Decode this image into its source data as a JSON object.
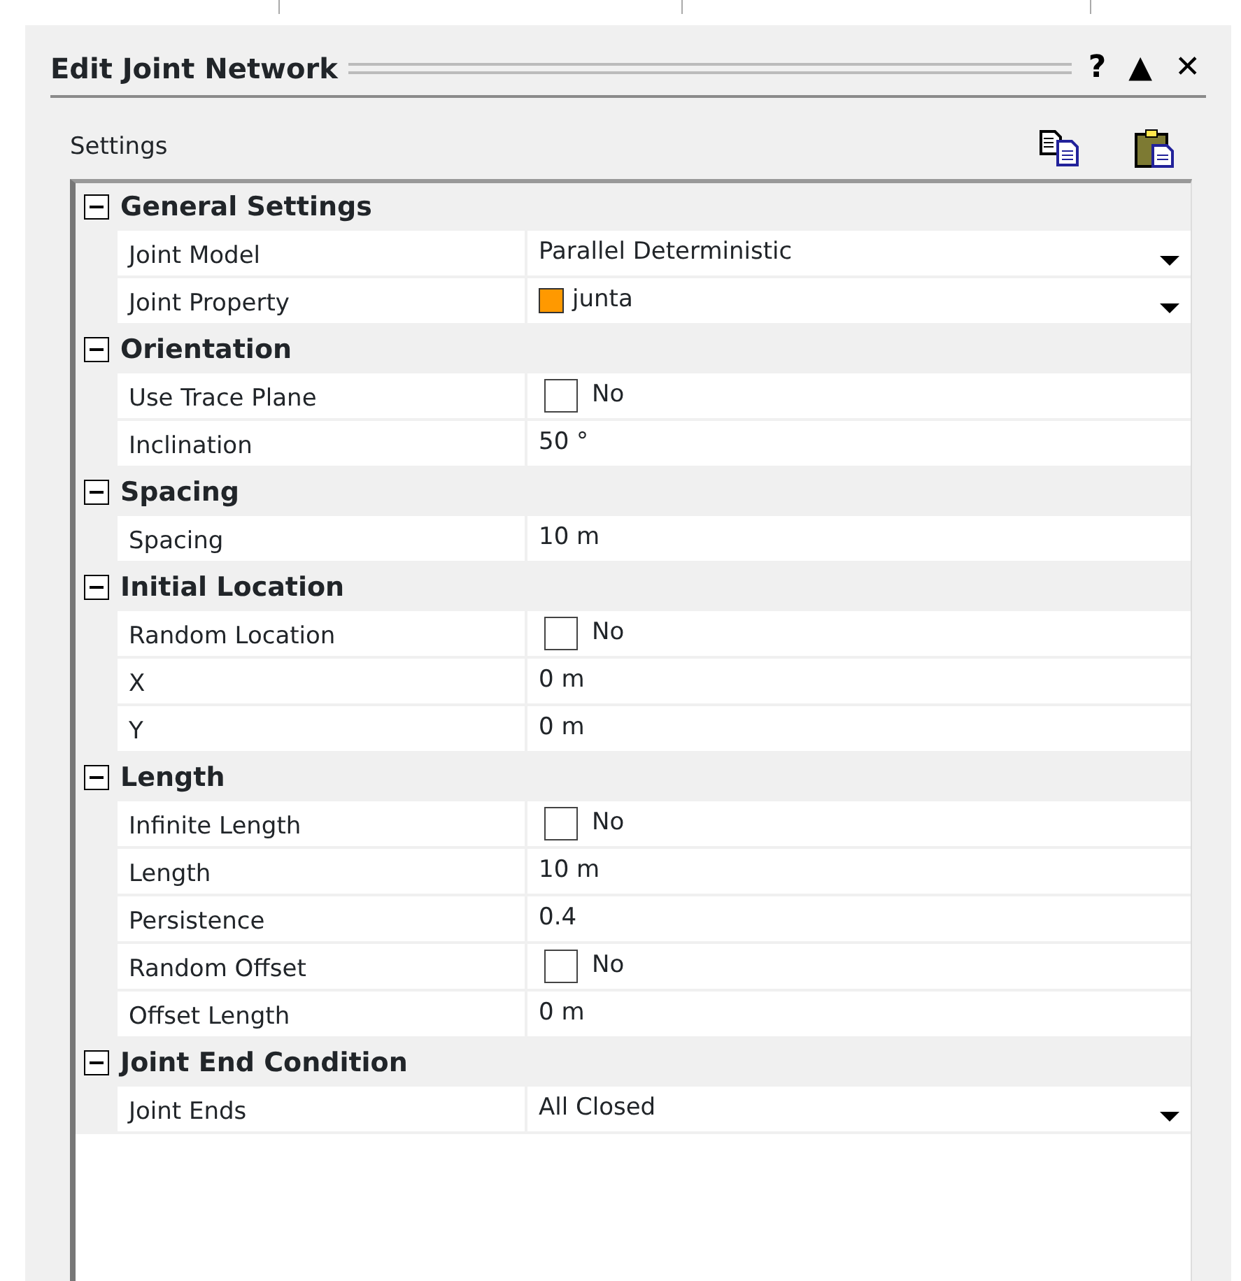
{
  "window": {
    "title": "Edit Joint Network",
    "buttons": [
      "?",
      "▲",
      "✕"
    ]
  },
  "section": {
    "title": "Settings"
  },
  "categories": [
    {
      "name": "General Settings",
      "expanded": true,
      "properties": [
        {
          "name": "Joint Model",
          "kind": "dropdown",
          "value": "Parallel Deterministic"
        },
        {
          "name": "Joint Property",
          "kind": "colordropdown",
          "value": "junta",
          "color": "#ff9900"
        }
      ]
    },
    {
      "name": "Orientation",
      "expanded": true,
      "properties": [
        {
          "name": "Use Trace Plane",
          "kind": "checkbox",
          "value": "No",
          "checked": false
        },
        {
          "name": "Inclination",
          "kind": "text",
          "value": "50 °"
        }
      ]
    },
    {
      "name": "Spacing",
      "expanded": true,
      "properties": [
        {
          "name": "Spacing",
          "kind": "text",
          "value": "10 m"
        }
      ]
    },
    {
      "name": "Initial Location",
      "expanded": true,
      "properties": [
        {
          "name": "Random Location",
          "kind": "checkbox",
          "value": "No",
          "checked": false
        },
        {
          "name": "X",
          "kind": "text",
          "value": "0 m"
        },
        {
          "name": "Y",
          "kind": "text",
          "value": "0 m"
        }
      ]
    },
    {
      "name": "Length",
      "expanded": true,
      "properties": [
        {
          "name": "Infinite Length",
          "kind": "checkbox",
          "value": "No",
          "checked": false
        },
        {
          "name": "Length",
          "kind": "text",
          "value": "10 m"
        },
        {
          "name": "Persistence",
          "kind": "text",
          "value": "0.4"
        },
        {
          "name": "Random Offset",
          "kind": "checkbox",
          "value": "No",
          "checked": false
        },
        {
          "name": "Offset Length",
          "kind": "text",
          "value": "0 m"
        }
      ]
    },
    {
      "name": "Joint End Condition",
      "expanded": true,
      "properties": [
        {
          "name": "Joint Ends",
          "kind": "dropdown",
          "value": "All Closed"
        }
      ]
    }
  ]
}
